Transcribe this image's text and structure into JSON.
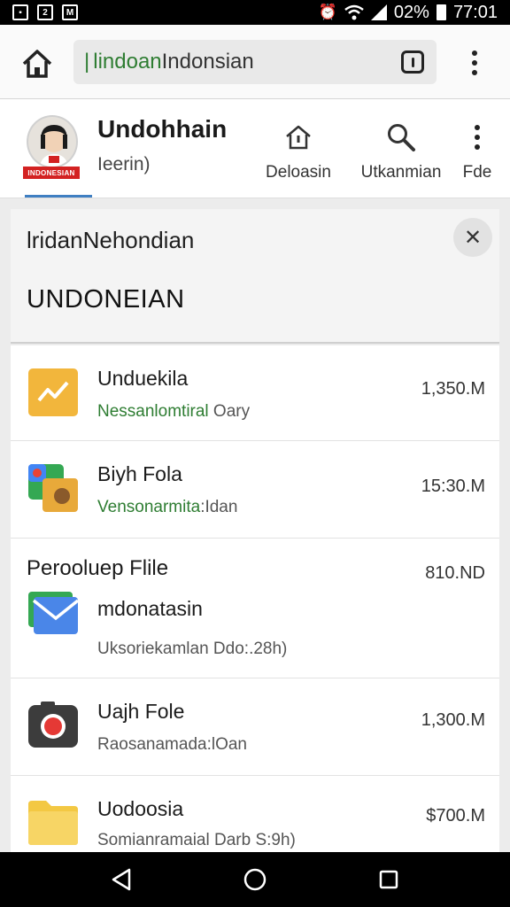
{
  "status_bar": {
    "battery": "02%",
    "time": "77:01",
    "icons": [
      "gallery-icon",
      "sync-icon",
      "gmail-icon",
      "alarm-icon",
      "wifi-icon",
      "signal-icon",
      "battery-icon"
    ]
  },
  "url_bar": {
    "url_green": "lindoan",
    "url_dark": "Indonsian",
    "icons": [
      "home-icon",
      "page-info-icon",
      "more-icon"
    ]
  },
  "site_header": {
    "title": "Undohhain",
    "subtitle": "Ieerin)",
    "avatar_badge": "INDONESIAN",
    "nav": [
      {
        "label": "Deloasin",
        "icon": "home-icon"
      },
      {
        "label": "Utkanmian",
        "icon": "search-icon"
      },
      {
        "label": "Fde",
        "icon": "more-icon"
      }
    ]
  },
  "panel": {
    "title": "lridanNehondian",
    "subtitle": "UNDONEIAN",
    "close_glyph": "✕"
  },
  "files": [
    {
      "name": "Unduekila",
      "meta_green": "Nessanlomtiral",
      "meta_rest": " Oary",
      "size": "1,350.M",
      "icon": "slides-file-icon"
    },
    {
      "name": "Biyh Fola",
      "meta_green": "Vensonarmita",
      "meta_rest": ":Idan",
      "size": "15:30.M",
      "icon": "photos-file-icon"
    },
    {
      "group_title": "Perooluep Flile",
      "name": "mdonatasin",
      "meta_green": "",
      "meta_rest": "Uksoriekamlan Ddo:.28h)",
      "size": "810.ND",
      "icon": "mail-file-icon"
    },
    {
      "name": "Uajh Fole",
      "meta_green": "",
      "meta_rest": "Raosanamada:lOan",
      "size": "1,300.M",
      "icon": "camera-file-icon"
    },
    {
      "name": "Uodoosia",
      "meta_green": "",
      "meta_rest": "Somianramaial Darb S:9h)",
      "size": "$700.M",
      "icon": "folder-file-icon"
    }
  ],
  "nav_bar": {
    "icons": [
      "back-icon",
      "home-circle-icon",
      "recents-icon"
    ]
  }
}
